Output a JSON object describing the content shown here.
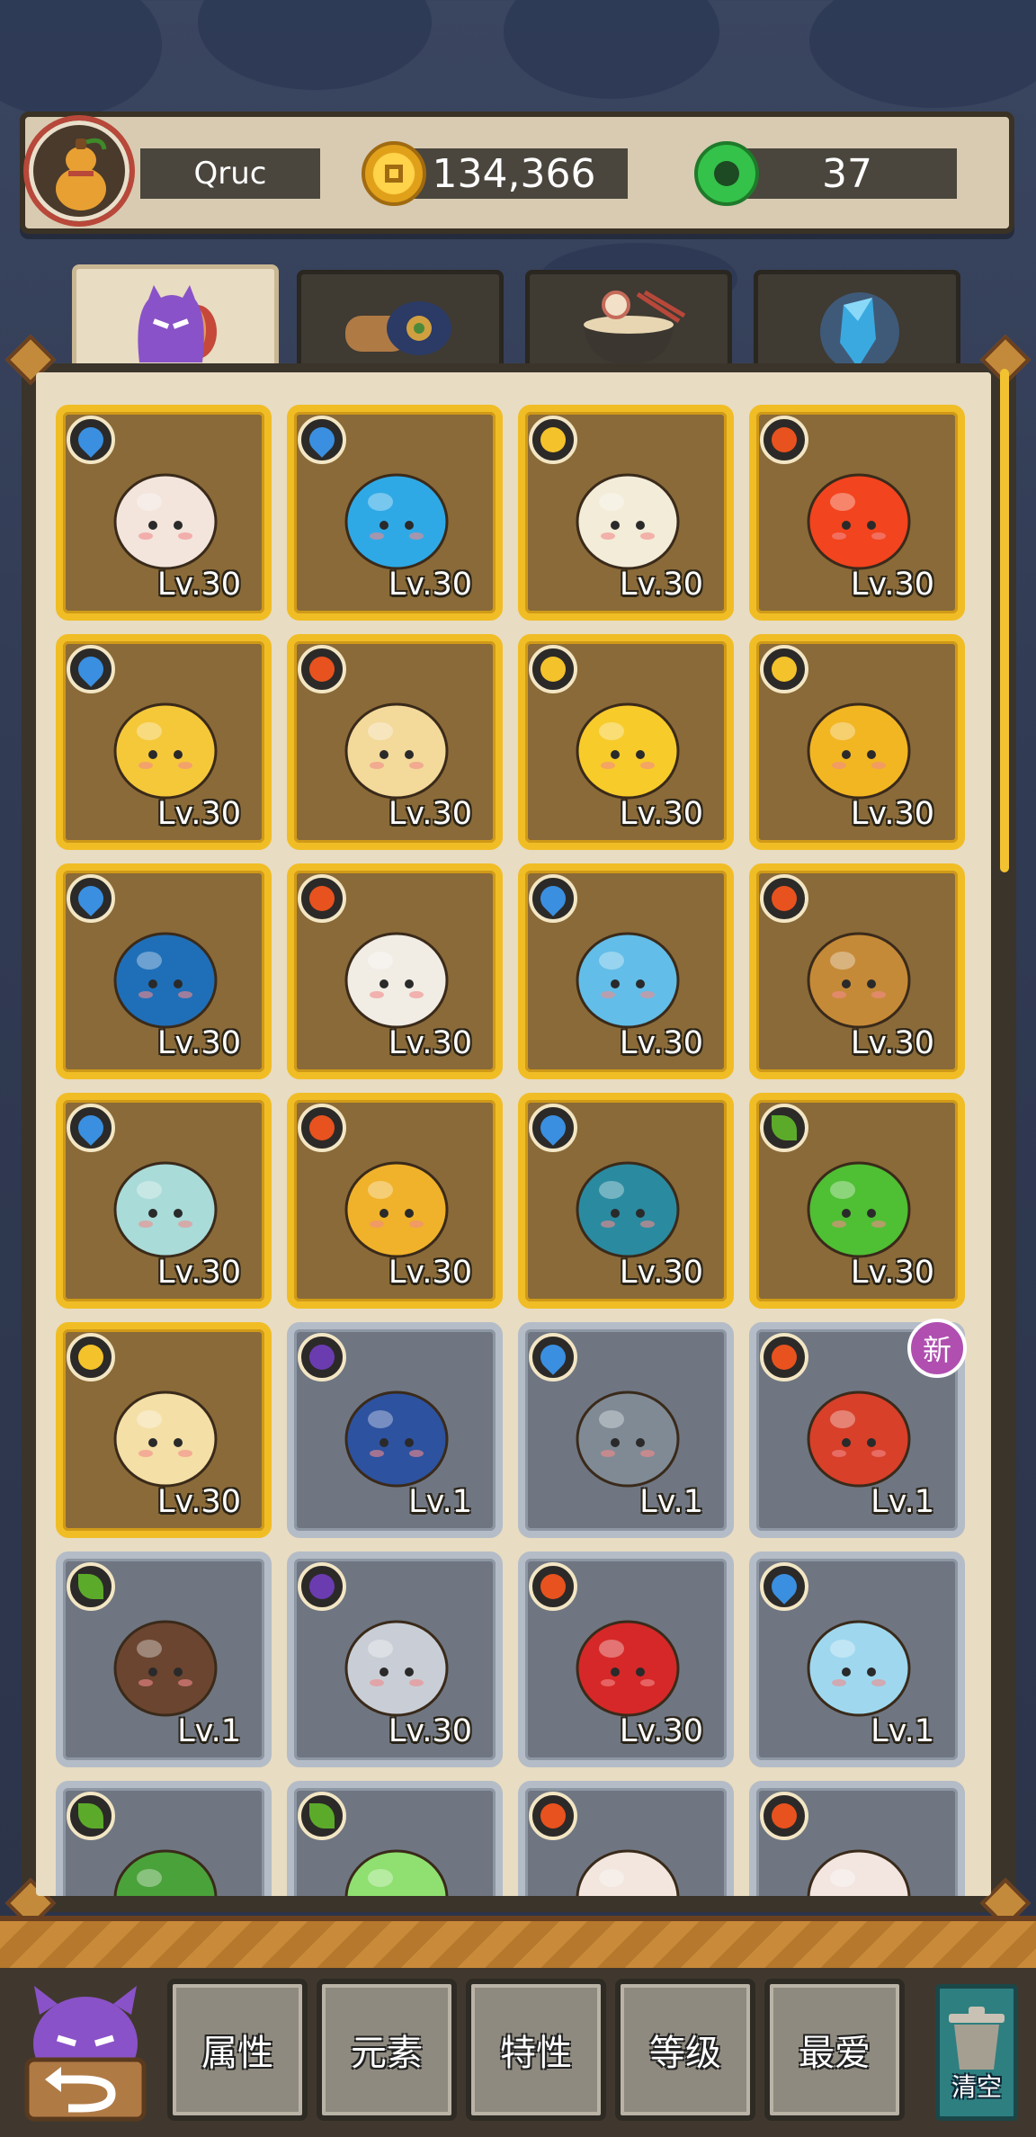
{
  "player": {
    "name": "Qruc",
    "coins": "134,366",
    "gems": "37"
  },
  "colors": {
    "gold_frame": "#f1bd25",
    "silver_frame": "#b4bcc7",
    "water": "#3a8fe0",
    "fire": "#e8521e",
    "sun": "#f4c22a",
    "leaf": "#5caa2a",
    "dark": "#6a3cb0"
  },
  "tabs": [
    {
      "name": "monsters",
      "icon": "purple-monster-icon",
      "active": true
    },
    {
      "name": "items",
      "icon": "wood-scroll-icon",
      "active": false
    },
    {
      "name": "food",
      "icon": "noodle-bowl-icon",
      "active": false
    },
    {
      "name": "crystals",
      "icon": "blue-crystal-icon",
      "active": false
    }
  ],
  "cards": [
    {
      "level": "Lv.30",
      "element": "water",
      "frame": "gold",
      "icon": "pig-chicken-monster-icon",
      "body": "#f3e4dc"
    },
    {
      "level": "Lv.30",
      "element": "water",
      "frame": "gold",
      "icon": "blue-star-monster-icon",
      "body": "#2fa9e6"
    },
    {
      "level": "Lv.30",
      "element": "sun",
      "frame": "gold",
      "icon": "snowman-monster-icon",
      "body": "#f2ecd8"
    },
    {
      "level": "Lv.30",
      "element": "fire",
      "frame": "gold",
      "icon": "flame-monster-icon",
      "body": "#f2441e"
    },
    {
      "level": "Lv.30",
      "element": "water",
      "frame": "gold",
      "icon": "cannon-chick-monster-icon",
      "body": "#f5c83a"
    },
    {
      "level": "Lv.30",
      "element": "fire",
      "frame": "gold",
      "icon": "dreamcatcher-monster-icon",
      "body": "#f3d99a"
    },
    {
      "level": "Lv.30",
      "element": "sun",
      "frame": "gold",
      "icon": "golden-orb-monster-icon",
      "body": "#f7cb2a"
    },
    {
      "level": "Lv.30",
      "element": "sun",
      "frame": "gold",
      "icon": "gourd-monster-icon",
      "body": "#f2b623"
    },
    {
      "level": "Lv.30",
      "element": "water",
      "frame": "gold",
      "icon": "bubble-monster-icon",
      "body": "#1f6fb8"
    },
    {
      "level": "Lv.30",
      "element": "fire",
      "frame": "gold",
      "icon": "white-cat-monster-icon",
      "body": "#f1ece4"
    },
    {
      "level": "Lv.30",
      "element": "water",
      "frame": "gold",
      "icon": "slime-monster-icon",
      "body": "#62bde8"
    },
    {
      "level": "Lv.30",
      "element": "fire",
      "frame": "gold",
      "icon": "lantern-monster-icon",
      "body": "#c58a38"
    },
    {
      "level": "Lv.30",
      "element": "water",
      "frame": "gold",
      "icon": "vase-monster-icon",
      "body": "#a9dbd8"
    },
    {
      "level": "Lv.30",
      "element": "fire",
      "frame": "gold",
      "icon": "leaf-monster-icon",
      "body": "#f0b22a"
    },
    {
      "level": "Lv.30",
      "element": "water",
      "frame": "gold",
      "icon": "rabbit-ghost-monster-icon",
      "body": "#2a8aa0"
    },
    {
      "level": "Lv.30",
      "element": "leaf",
      "frame": "gold",
      "icon": "green-slime-monster-icon",
      "body": "#4fbf34"
    },
    {
      "level": "Lv.30",
      "element": "sun",
      "frame": "gold",
      "icon": "chick-monster-icon",
      "body": "#f4dfa6"
    },
    {
      "level": "Lv.1",
      "element": "dark",
      "frame": "silver",
      "icon": "tongue-blob-monster-icon",
      "body": "#2d52a0"
    },
    {
      "level": "Lv.1",
      "element": "water",
      "frame": "silver",
      "icon": "gray-wolf-monster-icon",
      "body": "#7f8a95"
    },
    {
      "level": "Lv.1",
      "element": "fire",
      "frame": "silver",
      "icon": "red-scroll-monster-icon",
      "body": "#d8402a",
      "new": "新"
    },
    {
      "level": "Lv.1",
      "element": "leaf",
      "frame": "silver",
      "icon": "wood-stump-monster-icon",
      "body": "#6b4530"
    },
    {
      "level": "Lv.30",
      "element": "dark",
      "frame": "silver",
      "icon": "fish-monster-icon",
      "body": "#c9ced6"
    },
    {
      "level": "Lv.30",
      "element": "fire",
      "frame": "silver",
      "icon": "candy-coral-monster-icon",
      "body": "#d62828"
    },
    {
      "level": "Lv.1",
      "element": "water",
      "frame": "silver",
      "icon": "glass-vase-monster-icon",
      "body": "#9fd8ee"
    },
    {
      "level": "",
      "element": "leaf",
      "frame": "silver",
      "icon": "hat-monster-icon",
      "body": "#4aa23a"
    },
    {
      "level": "",
      "element": "leaf",
      "frame": "silver",
      "icon": "green-donut-monster-icon",
      "body": "#8fe070"
    },
    {
      "level": "",
      "element": "fire",
      "frame": "silver",
      "icon": "sushi-monster-icon",
      "body": "#f2e6de"
    },
    {
      "level": "",
      "element": "fire",
      "frame": "silver",
      "icon": "mochi-monster-icon",
      "body": "#f3e6e0"
    }
  ],
  "filters": [
    {
      "label": "属性",
      "icon": "attribute-filter"
    },
    {
      "label": "元素",
      "icon": "element-filter"
    },
    {
      "label": "特性",
      "icon": "trait-filter"
    },
    {
      "label": "等级",
      "icon": "level-filter"
    },
    {
      "label": "最爱",
      "icon": "favorite-filter"
    }
  ],
  "clear_label": "清空",
  "back_icon": "back-arrow-icon"
}
